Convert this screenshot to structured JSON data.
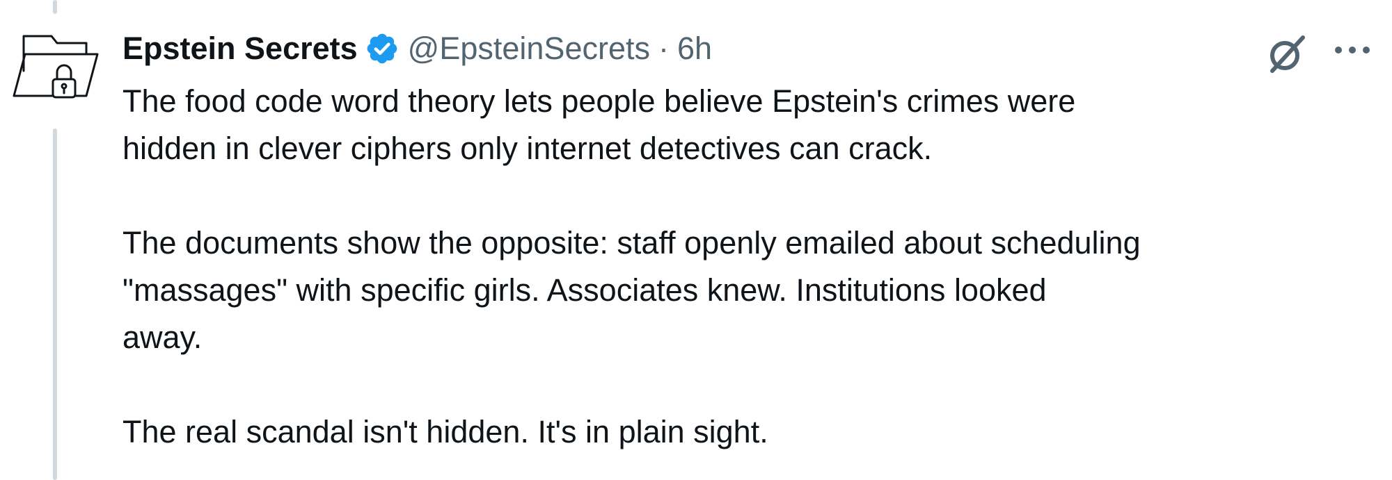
{
  "tweet": {
    "display_name": "Epstein Secrets",
    "handle": "@EpsteinSecrets",
    "separator": "·",
    "time": "6h",
    "paragraphs": [
      "The food code word theory lets people believe Epstein's crimes were\nhidden in clever ciphers only internet detectives can crack.",
      "The documents show the opposite: staff openly emailed about scheduling\n\"massages\" with specific girls. Associates knew. Institutions looked\naway.",
      "The real scandal isn't hidden. It's in plain sight."
    ]
  },
  "icons": {
    "avatar": "locked-folder-icon",
    "verified": "verified-badge-icon",
    "grok": "grok-icon",
    "more": "more-options-icon"
  },
  "colors": {
    "text": "#0f1419",
    "secondary_text": "#536471",
    "verified_blue": "#1d9bf0",
    "thread_line": "#cfd9de"
  }
}
